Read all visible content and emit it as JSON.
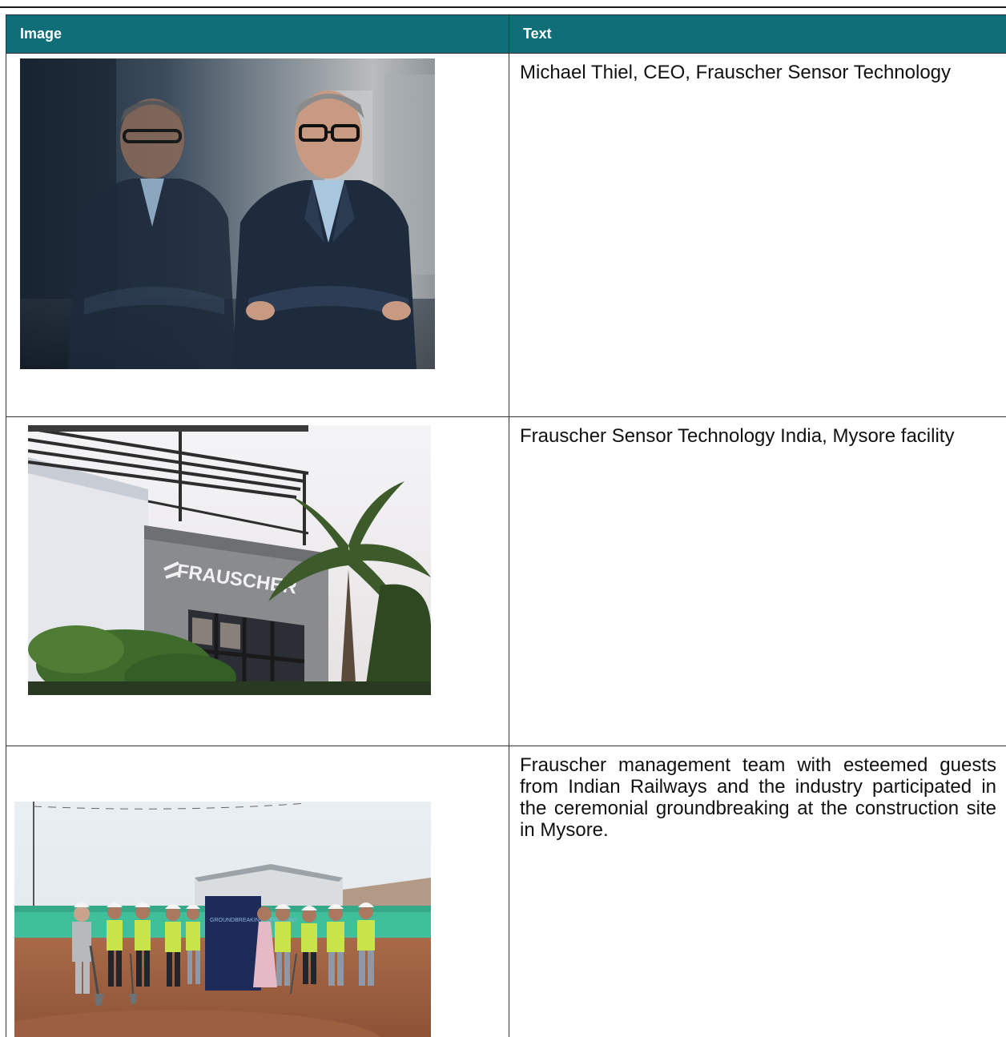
{
  "table": {
    "headers": {
      "image": "Image",
      "text": "Text"
    },
    "rows": [
      {
        "image_alt": "Portrait of Michael Thiel in a dark suit with arms crossed, reflected in a glass wall",
        "caption": "Michael Thiel, CEO, Frauscher Sensor Technology"
      },
      {
        "image_alt": "Frauscher building facade with signage and palm trees",
        "image_sign": "FRAUSCHER",
        "caption": "Frauscher Sensor Technology India, Mysore facility"
      },
      {
        "image_alt": "Group of people in safety vests and helmets at a groundbreaking ceremony on a construction site",
        "banner_title": "GROUNDBREAKING CEREMONY",
        "caption": "Frauscher management team with esteemed guests from Indian Railways and the industry participated in the ceremonial groundbreaking at the construction site in Mysore."
      }
    ]
  },
  "colors": {
    "header_bg": "#0f6e78",
    "header_text": "#ffffff",
    "border": "#333333"
  }
}
